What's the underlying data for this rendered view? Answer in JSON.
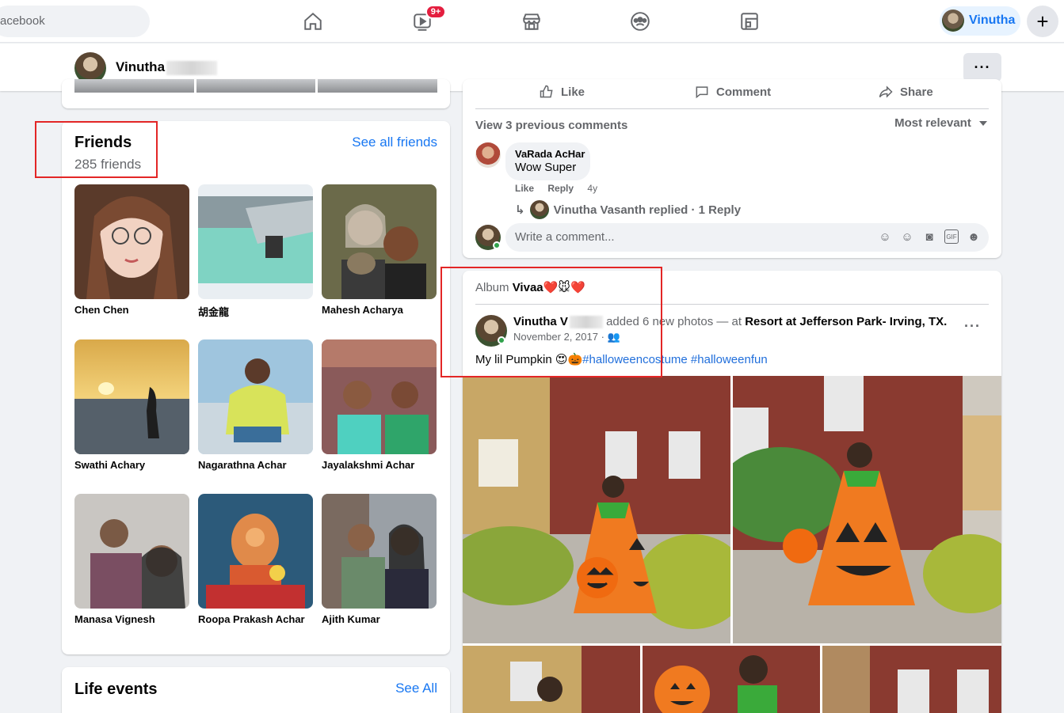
{
  "topbar": {
    "search_placeholder": "acebook",
    "watch_badge": "9+",
    "user_name": "Vinutha",
    "plus_symbol": "+",
    "nav_icons": [
      "home-icon",
      "watch-icon",
      "marketplace-icon",
      "groups-icon",
      "gaming-icon"
    ]
  },
  "profile_bar": {
    "name": "Vinutha",
    "more_label": "···"
  },
  "friends": {
    "title": "Friends",
    "count": "285 friends",
    "see_all": "See all friends",
    "items": [
      {
        "name": "Chen Chen"
      },
      {
        "name": "胡金龍"
      },
      {
        "name": "Mahesh Acharya"
      },
      {
        "name": "Swathi Achary"
      },
      {
        "name": "Nagarathna Achar"
      },
      {
        "name": "Jayalakshmi Achar"
      },
      {
        "name": "Manasa Vignesh"
      },
      {
        "name": "Roopa Prakash Achar"
      },
      {
        "name": "Ajith Kumar"
      }
    ]
  },
  "life_events": {
    "title": "Life events",
    "see_all": "See All"
  },
  "post_top": {
    "actions": {
      "like": "Like",
      "comment": "Comment",
      "share": "Share"
    },
    "view_previous": "View 3 previous comments",
    "sort": "Most relevant",
    "comment": {
      "author": "VaRada AcHar",
      "text": "Wow Super",
      "like": "Like",
      "reply": "Reply",
      "age": "4y"
    },
    "replied": "Vinutha Vasanth replied · 1 Reply",
    "write_placeholder": "Write a comment..."
  },
  "post_album": {
    "album_prefix": "Album",
    "album_name": "Vivaa❤️🐭❤️",
    "poster": "Vinutha V",
    "action": "added 6 new photos — at",
    "place": "Resort at Jefferson Park- Irving, TX.",
    "date": "November 2, 2017 ·",
    "caption_text": "My lil Pumpkin 😍🎃",
    "hashtags": "#halloweencostume #halloweenfun",
    "more_label": "···"
  }
}
